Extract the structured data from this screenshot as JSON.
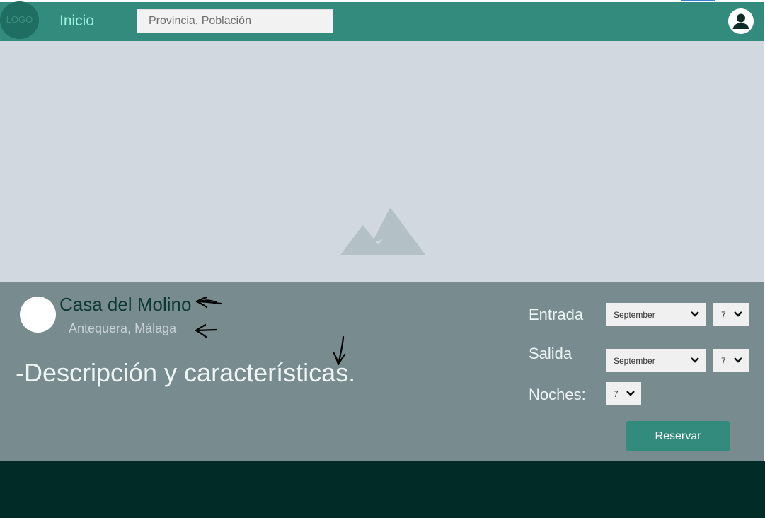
{
  "header": {
    "logo_text": "LOGO",
    "home_label": "Inicio",
    "search_placeholder": "Provincia, Población"
  },
  "listing": {
    "name": "Casa del Molino",
    "location": "Antequera, Málaga",
    "description": "-Descripción y características."
  },
  "booking": {
    "checkin_label": "Entrada",
    "checkin_month": "September",
    "checkin_day": "7",
    "checkout_label": "Salida",
    "checkout_month": "September",
    "checkout_day": "7",
    "nights_label": "Noches:",
    "nights_value": "7",
    "reserve_label": "Reservar"
  },
  "icons": {
    "user": "user-icon",
    "image_placeholder": "image-placeholder-icon",
    "chevron": "chevron-down-icon",
    "annotation_arrow": "arrow-annotation-icon"
  },
  "colors": {
    "header": "#338b7e",
    "hero": "#d1d8df",
    "panel": "#788b8f",
    "footer": "#002b26",
    "accent": "#338b7e"
  }
}
